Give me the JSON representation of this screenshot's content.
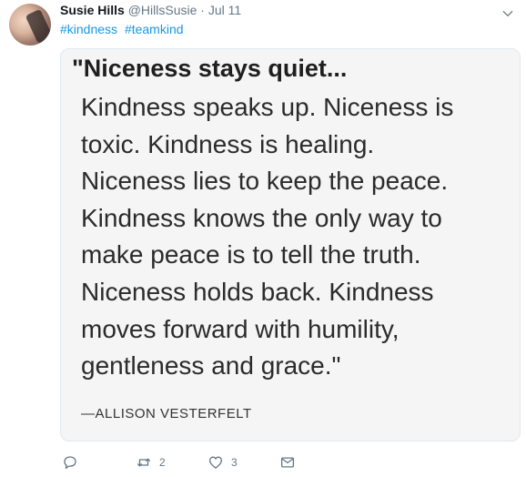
{
  "tweet": {
    "author_name": "Susie Hills",
    "author_handle": "@HillsSusie",
    "separator": "·",
    "date": "Jul 11",
    "hashtags": [
      "#kindness",
      "#teamkind"
    ]
  },
  "quote_image": {
    "title": "\"Niceness stays quiet...",
    "lines": [
      "Kindness speaks up. Niceness is",
      "toxic. Kindness is healing.",
      "Niceness lies to keep the peace.",
      "Kindness knows the only way to",
      "make peace is to tell the truth.",
      "Niceness holds back. Kindness",
      "moves forward with humility,",
      "gentleness and grace.\""
    ],
    "attribution": "—ALLISON VESTERFELT"
  },
  "actions": {
    "reply_icon": "reply-icon",
    "retweet_icon": "retweet-icon",
    "retweet_count": "2",
    "like_icon": "heart-icon",
    "like_count": "3",
    "dm_icon": "envelope-icon"
  },
  "colors": {
    "link": "#1b95e0",
    "muted": "#657786",
    "card_bg": "#f5f5f5"
  }
}
